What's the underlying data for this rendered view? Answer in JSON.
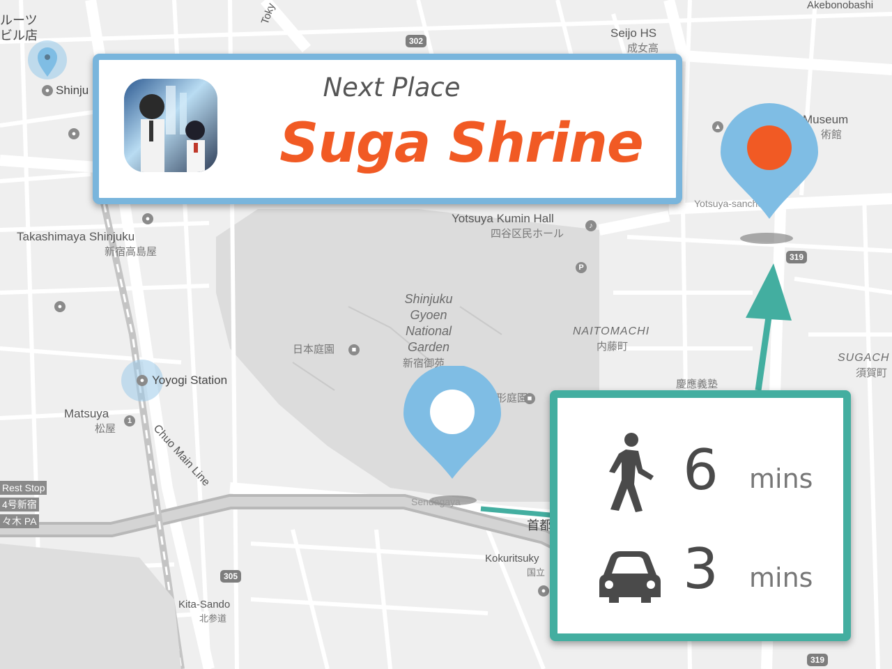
{
  "next_place": {
    "heading": "Next Place",
    "name": "Suga Shrine",
    "icon_name": "app-artwork-icon"
  },
  "travel": {
    "walk": {
      "value": "6",
      "unit": "mins",
      "icon": "walking-person-icon"
    },
    "drive": {
      "value": "3",
      "unit": "mins",
      "icon": "car-icon"
    }
  },
  "colors": {
    "accent_orange": "#f15a24",
    "pin_blue": "#7fbde4",
    "teal": "#43aea0",
    "card_border_blue": "#79b5dc"
  },
  "map": {
    "labels": {
      "takashimaya": "Takashimaya Shinjuku",
      "takashimaya_jp": "新宿高島屋",
      "shinjuku_partial": "Shinju",
      "fruits_jp": "ルーツ\nビル店",
      "seijo": "Seijo HS",
      "seijo_jp": "成女高",
      "museum": "Museum",
      "museum_jp": "術館",
      "yotsuya_kumin": "Yotsuya Kumin Hall",
      "yotsuya_kumin_jp": "四谷区民ホール",
      "yotsuya_san": "Yotsuya-sanchome",
      "park": "Shinjuku\nGyoen\nNational\nGarden",
      "park_jp": "新宿御苑",
      "nihonteien": "日本庭園",
      "keikei": "形庭園",
      "naitomachi": "NAITOMACHI",
      "naitomachi_jp": "内藤町",
      "sugacho": "SUGACH",
      "sugacho_jp": "須賀町",
      "keio_jp": "慶應義塾",
      "yoyogi": "Yoyogi Station",
      "matsuya": "Matsuya",
      "matsuya_jp": "松屋",
      "chuo": "Chuo Main Line",
      "rest_stop": "Rest Stop",
      "rest_jp1": "4号新宿",
      "rest_jp2": "々木 PA",
      "sendagaya": "Sendagaya",
      "kokuritsu": "Kokuritsuky",
      "kokuritsu_jp": "国立",
      "kitasando": "Kita-Sando",
      "kitasando_jp": "北参道",
      "akebonobashi": "Akebonobashi",
      "tokyo": "Toky",
      "shuto_jp": "首都"
    },
    "shields": {
      "r302": "302",
      "r319a": "319",
      "r319b": "319",
      "r305": "305"
    }
  }
}
